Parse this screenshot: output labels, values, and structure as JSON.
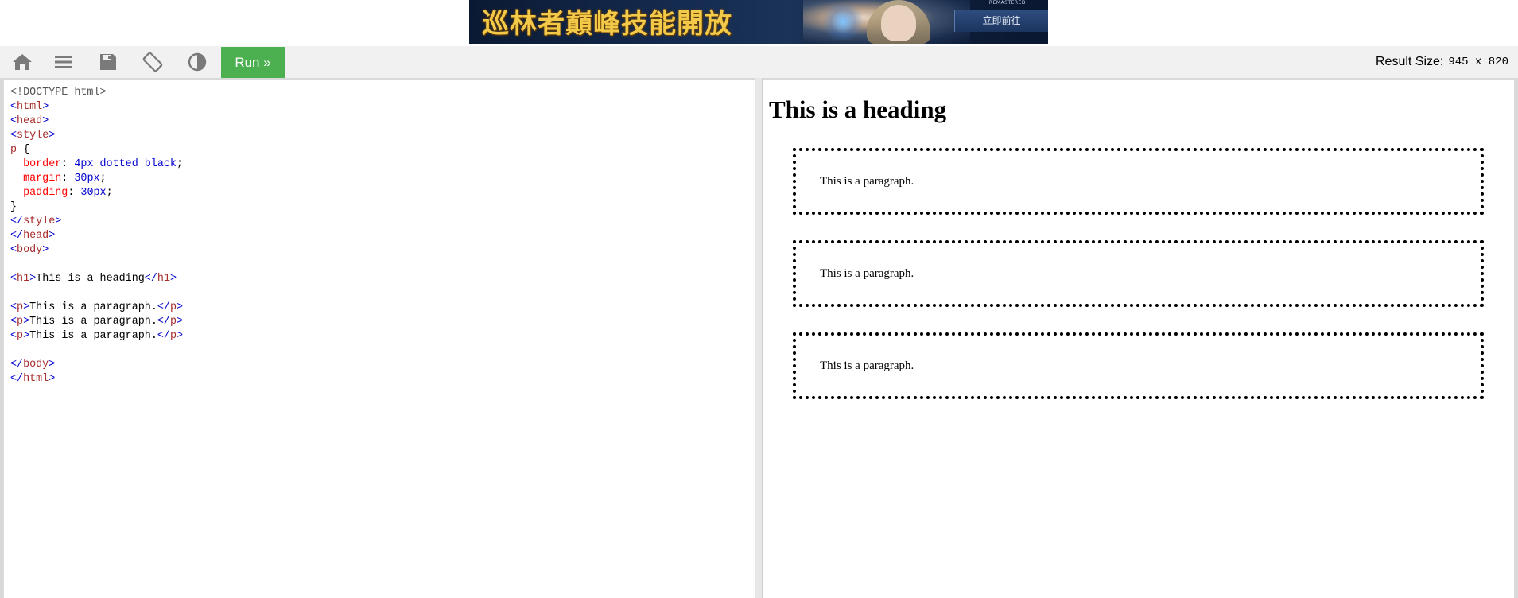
{
  "ad": {
    "title": "巡林者巔峰技能開放",
    "small_text": "REMASTERED",
    "cta": "立即前往"
  },
  "toolbar": {
    "icons": [
      "home-icon",
      "menu-icon",
      "save-icon",
      "rotate-icon",
      "contrast-icon"
    ],
    "run_label": "Run »",
    "result_size_label": "Result Size:",
    "result_size_value": "945 x 820"
  },
  "code_lines": [
    [
      {
        "c": "t-dt",
        "t": "<!DOCTYPE html>"
      }
    ],
    [
      {
        "c": "t-bracket",
        "t": "<"
      },
      {
        "c": "t-tag",
        "t": "html"
      },
      {
        "c": "t-bracket",
        "t": ">"
      }
    ],
    [
      {
        "c": "t-bracket",
        "t": "<"
      },
      {
        "c": "t-tag",
        "t": "head"
      },
      {
        "c": "t-bracket",
        "t": ">"
      }
    ],
    [
      {
        "c": "t-bracket",
        "t": "<"
      },
      {
        "c": "t-tag",
        "t": "style"
      },
      {
        "c": "t-bracket",
        "t": ">"
      }
    ],
    [
      {
        "c": "t-tag",
        "t": "p"
      },
      {
        "c": "t-txt",
        "t": " {"
      }
    ],
    [
      {
        "c": "t-txt",
        "t": "  "
      },
      {
        "c": "t-prop",
        "t": "border"
      },
      {
        "c": "t-txt",
        "t": ": "
      },
      {
        "c": "t-val",
        "t": "4px dotted black"
      },
      {
        "c": "t-txt",
        "t": ";"
      }
    ],
    [
      {
        "c": "t-txt",
        "t": "  "
      },
      {
        "c": "t-prop",
        "t": "margin"
      },
      {
        "c": "t-txt",
        "t": ": "
      },
      {
        "c": "t-val",
        "t": "30px"
      },
      {
        "c": "t-txt",
        "t": ";"
      }
    ],
    [
      {
        "c": "t-txt",
        "t": "  "
      },
      {
        "c": "t-prop",
        "t": "padding"
      },
      {
        "c": "t-txt",
        "t": ": "
      },
      {
        "c": "t-val",
        "t": "30px"
      },
      {
        "c": "t-txt",
        "t": ";"
      }
    ],
    [
      {
        "c": "t-txt",
        "t": "}"
      }
    ],
    [
      {
        "c": "t-bracket",
        "t": "</"
      },
      {
        "c": "t-tag",
        "t": "style"
      },
      {
        "c": "t-bracket",
        "t": ">"
      }
    ],
    [
      {
        "c": "t-bracket",
        "t": "</"
      },
      {
        "c": "t-tag",
        "t": "head"
      },
      {
        "c": "t-bracket",
        "t": ">"
      }
    ],
    [
      {
        "c": "t-bracket",
        "t": "<"
      },
      {
        "c": "t-tag",
        "t": "body"
      },
      {
        "c": "t-bracket",
        "t": ">"
      }
    ],
    [],
    [
      {
        "c": "t-bracket",
        "t": "<"
      },
      {
        "c": "t-tag",
        "t": "h1"
      },
      {
        "c": "t-bracket",
        "t": ">"
      },
      {
        "c": "t-txt",
        "t": "This is a heading"
      },
      {
        "c": "t-bracket",
        "t": "</"
      },
      {
        "c": "t-tag",
        "t": "h1"
      },
      {
        "c": "t-bracket",
        "t": ">"
      }
    ],
    [],
    [
      {
        "c": "t-bracket",
        "t": "<"
      },
      {
        "c": "t-tag",
        "t": "p"
      },
      {
        "c": "t-bracket",
        "t": ">"
      },
      {
        "c": "t-txt",
        "t": "This is a paragraph."
      },
      {
        "c": "t-bracket",
        "t": "</"
      },
      {
        "c": "t-tag",
        "t": "p"
      },
      {
        "c": "t-bracket",
        "t": ">"
      }
    ],
    [
      {
        "c": "t-bracket",
        "t": "<"
      },
      {
        "c": "t-tag",
        "t": "p"
      },
      {
        "c": "t-bracket",
        "t": ">"
      },
      {
        "c": "t-txt",
        "t": "This is a paragraph."
      },
      {
        "c": "t-bracket",
        "t": "</"
      },
      {
        "c": "t-tag",
        "t": "p"
      },
      {
        "c": "t-bracket",
        "t": ">"
      }
    ],
    [
      {
        "c": "t-bracket",
        "t": "<"
      },
      {
        "c": "t-tag",
        "t": "p"
      },
      {
        "c": "t-bracket",
        "t": ">"
      },
      {
        "c": "t-txt",
        "t": "This is a paragraph."
      },
      {
        "c": "t-bracket",
        "t": "</"
      },
      {
        "c": "t-tag",
        "t": "p"
      },
      {
        "c": "t-bracket",
        "t": ">"
      }
    ],
    [],
    [
      {
        "c": "t-bracket",
        "t": "</"
      },
      {
        "c": "t-tag",
        "t": "body"
      },
      {
        "c": "t-bracket",
        "t": ">"
      }
    ],
    [
      {
        "c": "t-bracket",
        "t": "</"
      },
      {
        "c": "t-tag",
        "t": "html"
      },
      {
        "c": "t-bracket",
        "t": ">"
      }
    ]
  ],
  "result": {
    "heading": "This is a heading",
    "paragraphs": [
      "This is a paragraph.",
      "This is a paragraph.",
      "This is a paragraph."
    ]
  },
  "colors": {
    "run_button": "#4caf50",
    "toolbar_bg": "#f1f1f1",
    "tag": "#a52a2a",
    "bracket": "#0000cd",
    "css_property": "#ff0000",
    "css_value": "#0000cd"
  }
}
